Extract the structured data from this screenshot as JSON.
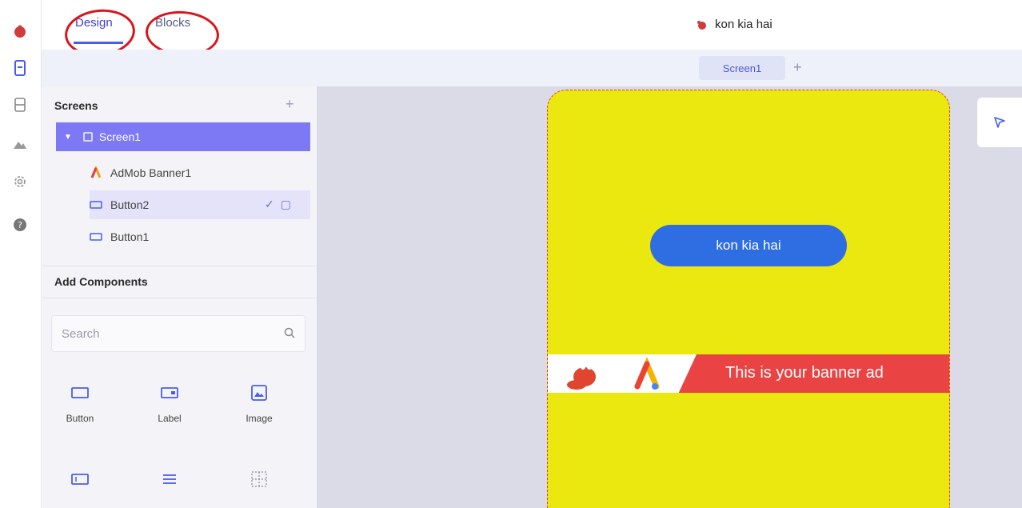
{
  "colors": {
    "accent": "#4a5cf0",
    "tree_selected": "#7d79f4",
    "phone_bg": "#ebe80f",
    "phone_button": "#2f6de3",
    "banner_red": "#e94343",
    "annotation_red": "#d9141b"
  },
  "rail": {
    "icons": [
      "app-logo-icon",
      "designer-icon",
      "storage-icon",
      "assets-icon",
      "settings-icon",
      "help-icon"
    ]
  },
  "topbar": {
    "tab_design": "Design",
    "tab_blocks": "Blocks",
    "project_name": "kon kia hai"
  },
  "subbar": {
    "screen_tab": "Screen1",
    "add_label": "+"
  },
  "screens_panel": {
    "title": "Screens",
    "add_label": "+",
    "root": "Screen1",
    "items": [
      "AdMob Banner1",
      "Button2",
      "Button1"
    ]
  },
  "components_panel": {
    "title": "Add Components",
    "search_placeholder": "Search",
    "components": [
      "Button",
      "Label",
      "Image"
    ]
  },
  "phone": {
    "button_text": "kon kia hai",
    "banner_text": "This is your banner ad"
  }
}
